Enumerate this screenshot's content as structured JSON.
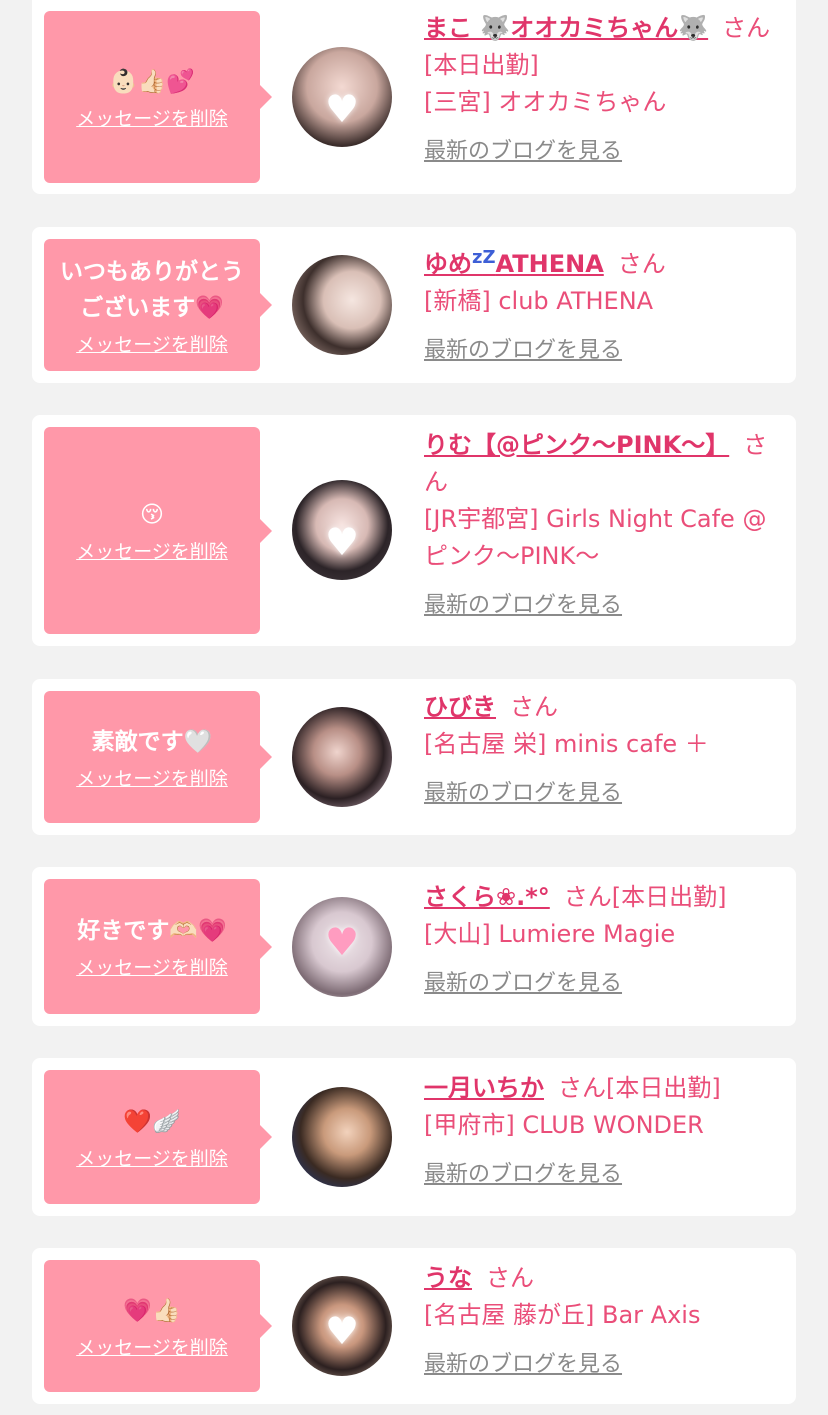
{
  "san_label": "さん",
  "delete_label": "メッセージを削除",
  "blog_label": "最新のブログを見る",
  "cards": [
    {
      "message": "👶🏻👍🏻💕",
      "name": "まこ 🐺オオカミちゃん🐺",
      "status": "[本日出勤]",
      "shop": "[三宮] オオカミちゃん"
    },
    {
      "message": "いつもありがとうございます💗",
      "name_a": "ゆめ",
      "name_b": "z",
      "name_c": "Z",
      "name_d": "ATHENA",
      "status": "",
      "shop": "[新橋] club ATHENA"
    },
    {
      "message": "😚",
      "name": "りむ【@ピンク〜PINK〜】",
      "status": "",
      "shop": "[JR宇都宮] Girls Night Cafe @ピンク〜PINK〜"
    },
    {
      "message": "素敵です🤍",
      "name": "ひびき",
      "status": "",
      "shop": "[名古屋 栄] minis cafe ＋"
    },
    {
      "message": "好きです🫶🏻💗",
      "name": "さくら❀.*°",
      "status": "[本日出勤]",
      "shop": "[大山] Lumiere Magie"
    },
    {
      "message": "❤️🪽",
      "name": "一月いちか",
      "status": "[本日出勤]",
      "shop": "[甲府市] CLUB WONDER"
    },
    {
      "message": "💗👍🏻",
      "name": "うな",
      "status": "",
      "shop": "[名古屋 藤が丘] Bar Axis"
    }
  ],
  "colors": {
    "bubble": "#ff98a9",
    "name": "#e0356a",
    "text": "#ea4e79",
    "blog": "#8a8a8a"
  }
}
